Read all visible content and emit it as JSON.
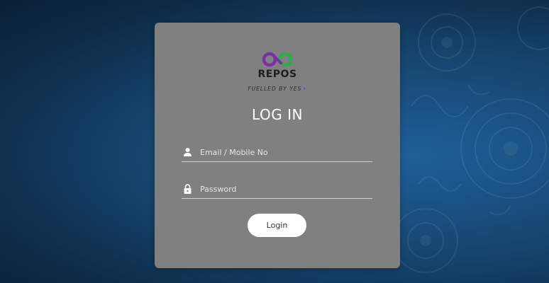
{
  "colors": {
    "background": "#16456f",
    "card": "#808080",
    "logo_purple": "#7a2fa3",
    "logo_green": "#2faa4c",
    "button_bg": "#ffffff"
  },
  "logo": {
    "name": "REPOS",
    "tagline": "FUELLED BY YES"
  },
  "login": {
    "title": "LOG IN",
    "email_placeholder": "Email / Mobile No",
    "email_icon": "user-icon",
    "password_placeholder": "Password",
    "password_icon": "lock-icon",
    "button_label": "Login"
  }
}
